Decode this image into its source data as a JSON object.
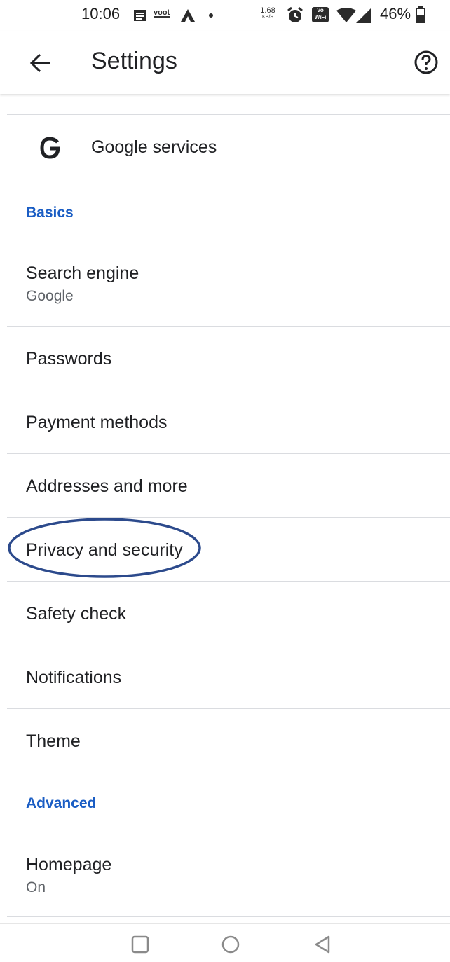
{
  "status_bar": {
    "time": "10:06",
    "network_speed": "1.68",
    "network_speed_unit": "KB/S",
    "voot_label": "voot",
    "wifi_calling_label": "Vo WiFi",
    "battery_percent": "46%"
  },
  "app_bar": {
    "title": "Settings",
    "back_icon": "arrow-back-icon",
    "help_icon": "help-circle-icon"
  },
  "rows": {
    "google_services": {
      "title": "Google services",
      "icon": "google-g-icon"
    },
    "basics_header": "Basics",
    "search_engine": {
      "title": "Search engine",
      "value": "Google"
    },
    "passwords": {
      "title": "Passwords"
    },
    "payment_methods": {
      "title": "Payment methods"
    },
    "addresses": {
      "title": "Addresses and more"
    },
    "privacy": {
      "title": "Privacy and security"
    },
    "safety_check": {
      "title": "Safety check"
    },
    "notifications": {
      "title": "Notifications"
    },
    "theme": {
      "title": "Theme"
    },
    "advanced_header": "Advanced",
    "homepage": {
      "title": "Homepage",
      "value": "On"
    }
  },
  "annotation": {
    "color": "#2c4a8c"
  },
  "nav_bar": {
    "recents_icon": "square-icon",
    "home_icon": "circle-icon",
    "back_icon": "triangle-back-icon"
  },
  "colors": {
    "section_header": "#1a5dc4",
    "divider": "#dadce0",
    "text_primary": "#202124",
    "text_secondary": "#5f6368"
  }
}
